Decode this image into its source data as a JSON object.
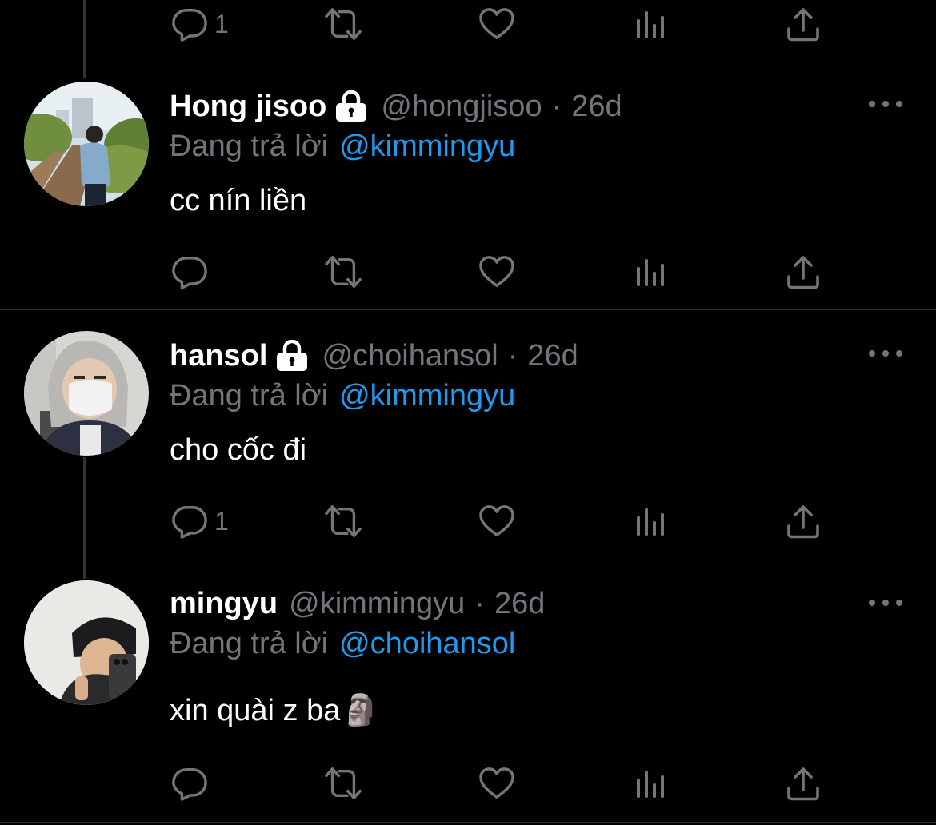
{
  "colors": {
    "background": "#000000",
    "secondary_text": "#71767b",
    "mention": "#1d9bf0",
    "divider": "#2f3336"
  },
  "top_actions": {
    "reply_count": "1"
  },
  "tweets": [
    {
      "name": "Hong jisoo",
      "locked": true,
      "handle": "@hongjisoo",
      "separator": "·",
      "time": "26d",
      "reply_prefix": "Đang trả lời",
      "reply_to": "@kimmingyu",
      "text": "cc nín liền",
      "reply_count": ""
    },
    {
      "name": "hansol",
      "locked": true,
      "handle": "@choihansol",
      "separator": "·",
      "time": "26d",
      "reply_prefix": "Đang trả lời",
      "reply_to": "@kimmingyu",
      "text": "cho cốc đi",
      "reply_count": "1"
    },
    {
      "name": "mingyu",
      "locked": false,
      "handle": "@kimmingyu",
      "separator": "·",
      "time": "26d",
      "reply_prefix": "Đang trả lời",
      "reply_to": "@choihansol",
      "text": "xin quài z ba",
      "emoji": "🗿",
      "reply_count": ""
    }
  ],
  "icons": [
    "reply-icon",
    "retweet-icon",
    "like-icon",
    "analytics-icon",
    "share-icon",
    "lock-icon",
    "more-icon",
    "moai-emoji"
  ]
}
